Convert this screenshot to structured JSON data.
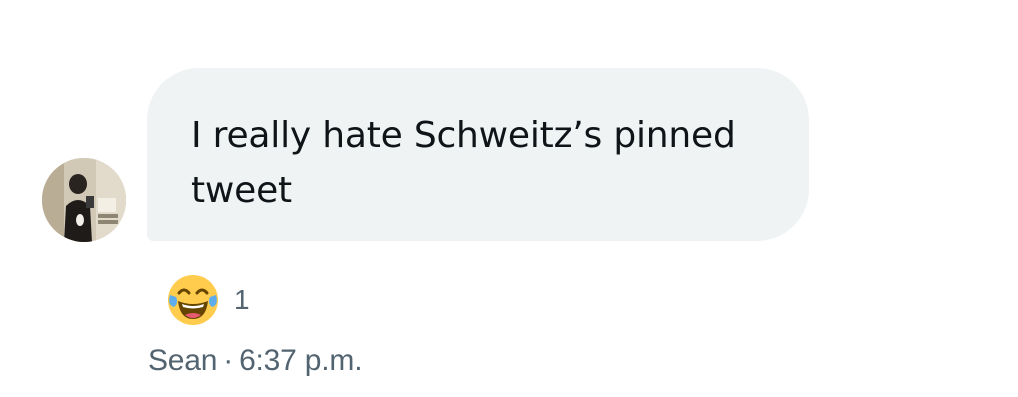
{
  "message": {
    "text": "I really hate Schweitz’s pinned tweet",
    "sender": "Sean",
    "separator": "·",
    "time": "6:37 p.m.",
    "bubble_color": "#eff3f4",
    "text_color": "#0f1419"
  },
  "reaction": {
    "emoji_icon": "face-with-tears-of-joy-icon",
    "count": "1"
  },
  "colors": {
    "meta_text": "#536471"
  }
}
